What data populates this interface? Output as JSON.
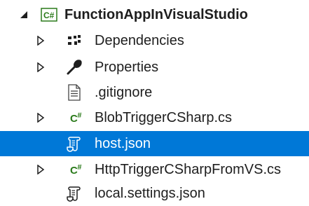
{
  "solution_explorer": {
    "project": {
      "label": "FunctionAppInVisualStudio",
      "icon": "csharp-project-icon",
      "expanded": true
    },
    "items": [
      {
        "label": "Dependencies",
        "icon": "dependencies-icon",
        "expandable": true,
        "selected": false
      },
      {
        "label": "Properties",
        "icon": "wrench-icon",
        "expandable": true,
        "selected": false
      },
      {
        "label": ".gitignore",
        "icon": "text-file-icon",
        "expandable": false,
        "selected": false
      },
      {
        "label": "BlobTriggerCSharp.cs",
        "icon": "csharp-file-icon",
        "expandable": true,
        "selected": false
      },
      {
        "label": "host.json",
        "icon": "json-file-icon",
        "expandable": false,
        "selected": true
      },
      {
        "label": "HttpTriggerCSharpFromVS.cs",
        "icon": "csharp-file-icon",
        "expandable": true,
        "selected": false
      },
      {
        "label": "local.settings.json",
        "icon": "json-file-icon",
        "expandable": false,
        "selected": false
      }
    ],
    "colors": {
      "selection": "#0078d7",
      "csharp": "#2a7a1a",
      "text": "#1e1e1e"
    }
  }
}
